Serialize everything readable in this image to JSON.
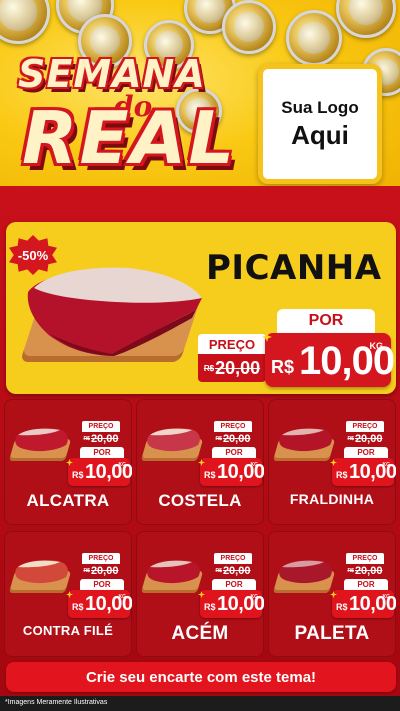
{
  "header": {
    "title_top": "SEMANA",
    "title_connector": "do",
    "title_bottom": "REAL",
    "logo_line1": "Sua Logo",
    "logo_line2": "Aqui"
  },
  "featured": {
    "discount_badge": "-50%",
    "name": "PICANHA",
    "price_label": "PREÇO",
    "old_currency": "R$",
    "old_price": "20,00",
    "por_label": "POR",
    "currency": "R$",
    "new_price": "10,00",
    "unit": "KG"
  },
  "products": [
    {
      "name": "ALCATRA",
      "price_label": "PREÇO",
      "old_currency": "R$",
      "old_price": "20,00",
      "por_label": "POR",
      "currency": "R$",
      "new_price": "10,00",
      "unit": "KG"
    },
    {
      "name": "COSTELA",
      "price_label": "PREÇO",
      "old_currency": "R$",
      "old_price": "20,00",
      "por_label": "POR",
      "currency": "R$",
      "new_price": "10,00",
      "unit": "KG"
    },
    {
      "name": "FRALDINHA",
      "price_label": "PREÇO",
      "old_currency": "R$",
      "old_price": "20,00",
      "por_label": "POR",
      "currency": "R$",
      "new_price": "10,00",
      "unit": "KG"
    },
    {
      "name": "CONTRA FILÉ",
      "price_label": "PREÇO",
      "old_currency": "R$",
      "old_price": "20,00",
      "por_label": "POR",
      "currency": "R$",
      "new_price": "10,00",
      "unit": "KG"
    },
    {
      "name": "ACÉM",
      "price_label": "PREÇO",
      "old_currency": "R$",
      "old_price": "20,00",
      "por_label": "POR",
      "currency": "R$",
      "new_price": "10,00",
      "unit": "KG"
    },
    {
      "name": "PALETA",
      "price_label": "PREÇO",
      "old_currency": "R$",
      "old_price": "20,00",
      "por_label": "POR",
      "currency": "R$",
      "new_price": "10,00",
      "unit": "KG"
    }
  ],
  "cta": "Crie seu encarte com este tema!",
  "disclaimer": "*Imagens Meramente Ilustrativas",
  "colors": {
    "brand_red": "#d4161f",
    "brand_yellow": "#f7cd1d",
    "dark_red": "#b10f18"
  }
}
